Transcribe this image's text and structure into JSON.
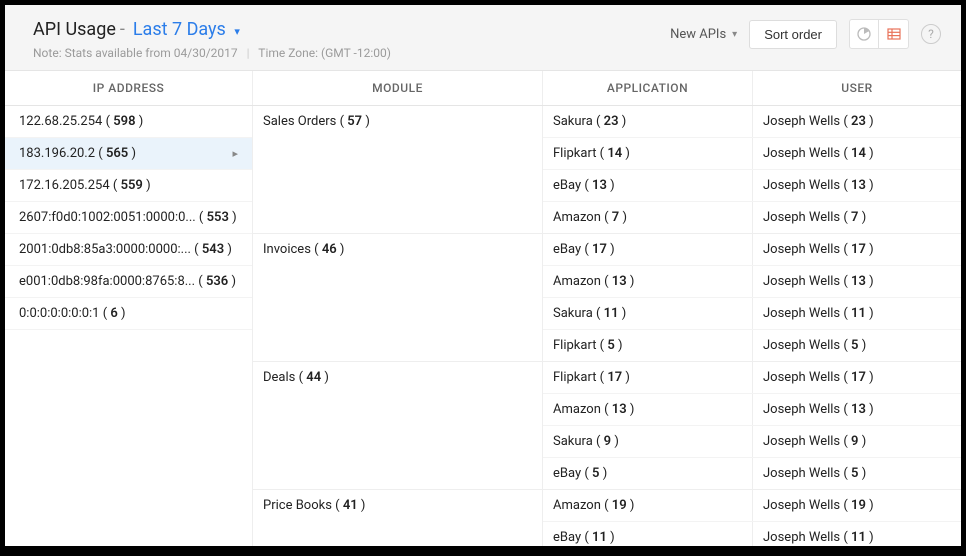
{
  "header": {
    "title": "API Usage",
    "period": "Last 7 Days",
    "note_prefix": "Note: Stats available from 04/30/2017",
    "timezone": "Time Zone: (GMT -12:00)",
    "new_apis_label": "New APIs",
    "sort_label": "Sort order"
  },
  "columns": {
    "ip": "IP ADDRESS",
    "module": "MODULE",
    "application": "APPLICATION",
    "user": "USER"
  },
  "ip_list": [
    {
      "ip": "122.68.25.254",
      "count": 598,
      "selected": false
    },
    {
      "ip": "183.196.20.2",
      "count": 565,
      "selected": true
    },
    {
      "ip": "172.16.205.254",
      "count": 559,
      "selected": false
    },
    {
      "ip": "2607:f0d0:1002:0051:0000:0...",
      "count": 553,
      "selected": false
    },
    {
      "ip": "2001:0db8:85a3:0000:0000:...",
      "count": 543,
      "selected": false
    },
    {
      "ip": "e001:0db8:98fa:0000:8765:8...",
      "count": 536,
      "selected": false
    },
    {
      "ip": "0:0:0:0:0:0:0:1",
      "count": 6,
      "selected": false
    }
  ],
  "modules": [
    {
      "name": "Sales Orders",
      "count": 57,
      "rows": [
        {
          "app": "Sakura",
          "app_count": 23,
          "user": "Joseph Wells",
          "user_count": 23
        },
        {
          "app": "Flipkart",
          "app_count": 14,
          "user": "Joseph Wells",
          "user_count": 14
        },
        {
          "app": "eBay",
          "app_count": 13,
          "user": "Joseph Wells",
          "user_count": 13
        },
        {
          "app": "Amazon",
          "app_count": 7,
          "user": "Joseph Wells",
          "user_count": 7
        }
      ]
    },
    {
      "name": "Invoices",
      "count": 46,
      "rows": [
        {
          "app": "eBay",
          "app_count": 17,
          "user": "Joseph Wells",
          "user_count": 17
        },
        {
          "app": "Amazon",
          "app_count": 13,
          "user": "Joseph Wells",
          "user_count": 13
        },
        {
          "app": "Sakura",
          "app_count": 11,
          "user": "Joseph Wells",
          "user_count": 11
        },
        {
          "app": "Flipkart",
          "app_count": 5,
          "user": "Joseph Wells",
          "user_count": 5
        }
      ]
    },
    {
      "name": "Deals",
      "count": 44,
      "rows": [
        {
          "app": "Flipkart",
          "app_count": 17,
          "user": "Joseph Wells",
          "user_count": 17
        },
        {
          "app": "Amazon",
          "app_count": 13,
          "user": "Joseph Wells",
          "user_count": 13
        },
        {
          "app": "Sakura",
          "app_count": 9,
          "user": "Joseph Wells",
          "user_count": 9
        },
        {
          "app": "eBay",
          "app_count": 5,
          "user": "Joseph Wells",
          "user_count": 5
        }
      ]
    },
    {
      "name": "Price Books",
      "count": 41,
      "rows": [
        {
          "app": "Amazon",
          "app_count": 19,
          "user": "Joseph Wells",
          "user_count": 19
        },
        {
          "app": "eBay",
          "app_count": 11,
          "user": "Joseph Wells",
          "user_count": 11
        }
      ]
    }
  ]
}
